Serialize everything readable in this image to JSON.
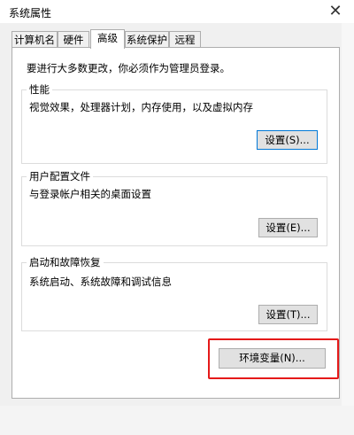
{
  "window": {
    "title": "系统属性",
    "close_glyph": "✕"
  },
  "tabs": [
    {
      "label": "计算机名"
    },
    {
      "label": "硬件"
    },
    {
      "label": "高级",
      "active": true
    },
    {
      "label": "系统保护"
    },
    {
      "label": "远程"
    }
  ],
  "intro_text": "要进行大多数更改，你必须作为管理员登录。",
  "performance": {
    "title": "性能",
    "description": "视觉效果，处理器计划，内存使用，以及虚拟内存",
    "button": "设置(S)..."
  },
  "user_profiles": {
    "title": "用户配置文件",
    "description": "与登录帐户相关的桌面设置",
    "button": "设置(E)..."
  },
  "startup_recovery": {
    "title": "启动和故障恢复",
    "description": "系统启动、系统故障和调试信息",
    "button": "设置(T)..."
  },
  "env_button": "环境变量(N)...",
  "colors": {
    "highlight": "#e51919",
    "focus": "#0078d7"
  }
}
